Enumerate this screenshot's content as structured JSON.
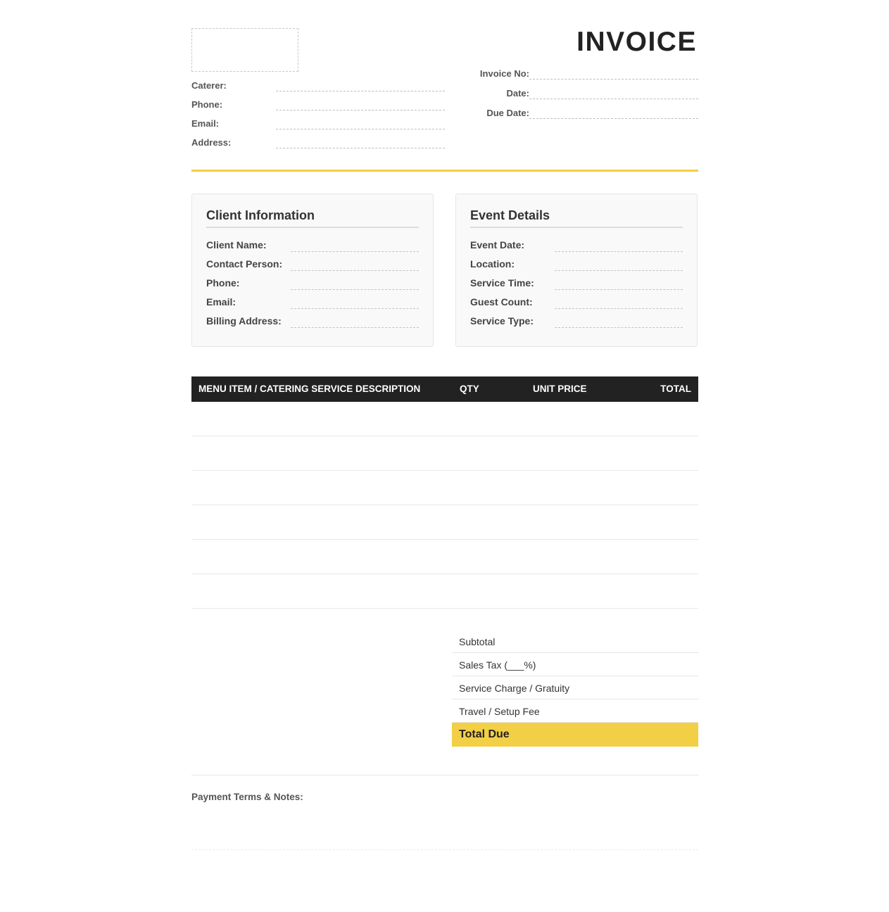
{
  "header": {
    "title": "INVOICE"
  },
  "caterer": {
    "fields": [
      "Caterer:",
      "Phone:",
      "Email:",
      "Address:"
    ]
  },
  "meta": {
    "fields": [
      "Invoice No:",
      "Date:",
      "Due Date:"
    ]
  },
  "client": {
    "title": "Client Information",
    "fields": [
      "Client Name:",
      "Contact Person:",
      "Phone:",
      "Email:",
      "Billing Address:"
    ]
  },
  "event": {
    "title": "Event Details",
    "fields": [
      "Event Date:",
      "Location:",
      "Service Time:",
      "Guest Count:",
      "Service Type:"
    ]
  },
  "table": {
    "headers": {
      "description": "MENU ITEM / CATERING SERVICE DESCRIPTION",
      "qty": "QTY",
      "unit_price": "UNIT PRICE",
      "total": "TOTAL"
    }
  },
  "totals": {
    "subtotal": "Subtotal",
    "sales_tax": "Sales Tax (___%)",
    "service_charge": "Service Charge / Gratuity",
    "travel_fee": "Travel / Setup Fee",
    "total_due": "Total Due"
  },
  "notes": {
    "label": "Payment Terms & Notes:"
  },
  "colors": {
    "accent": "#f2ce46",
    "header_bg": "#222222"
  }
}
